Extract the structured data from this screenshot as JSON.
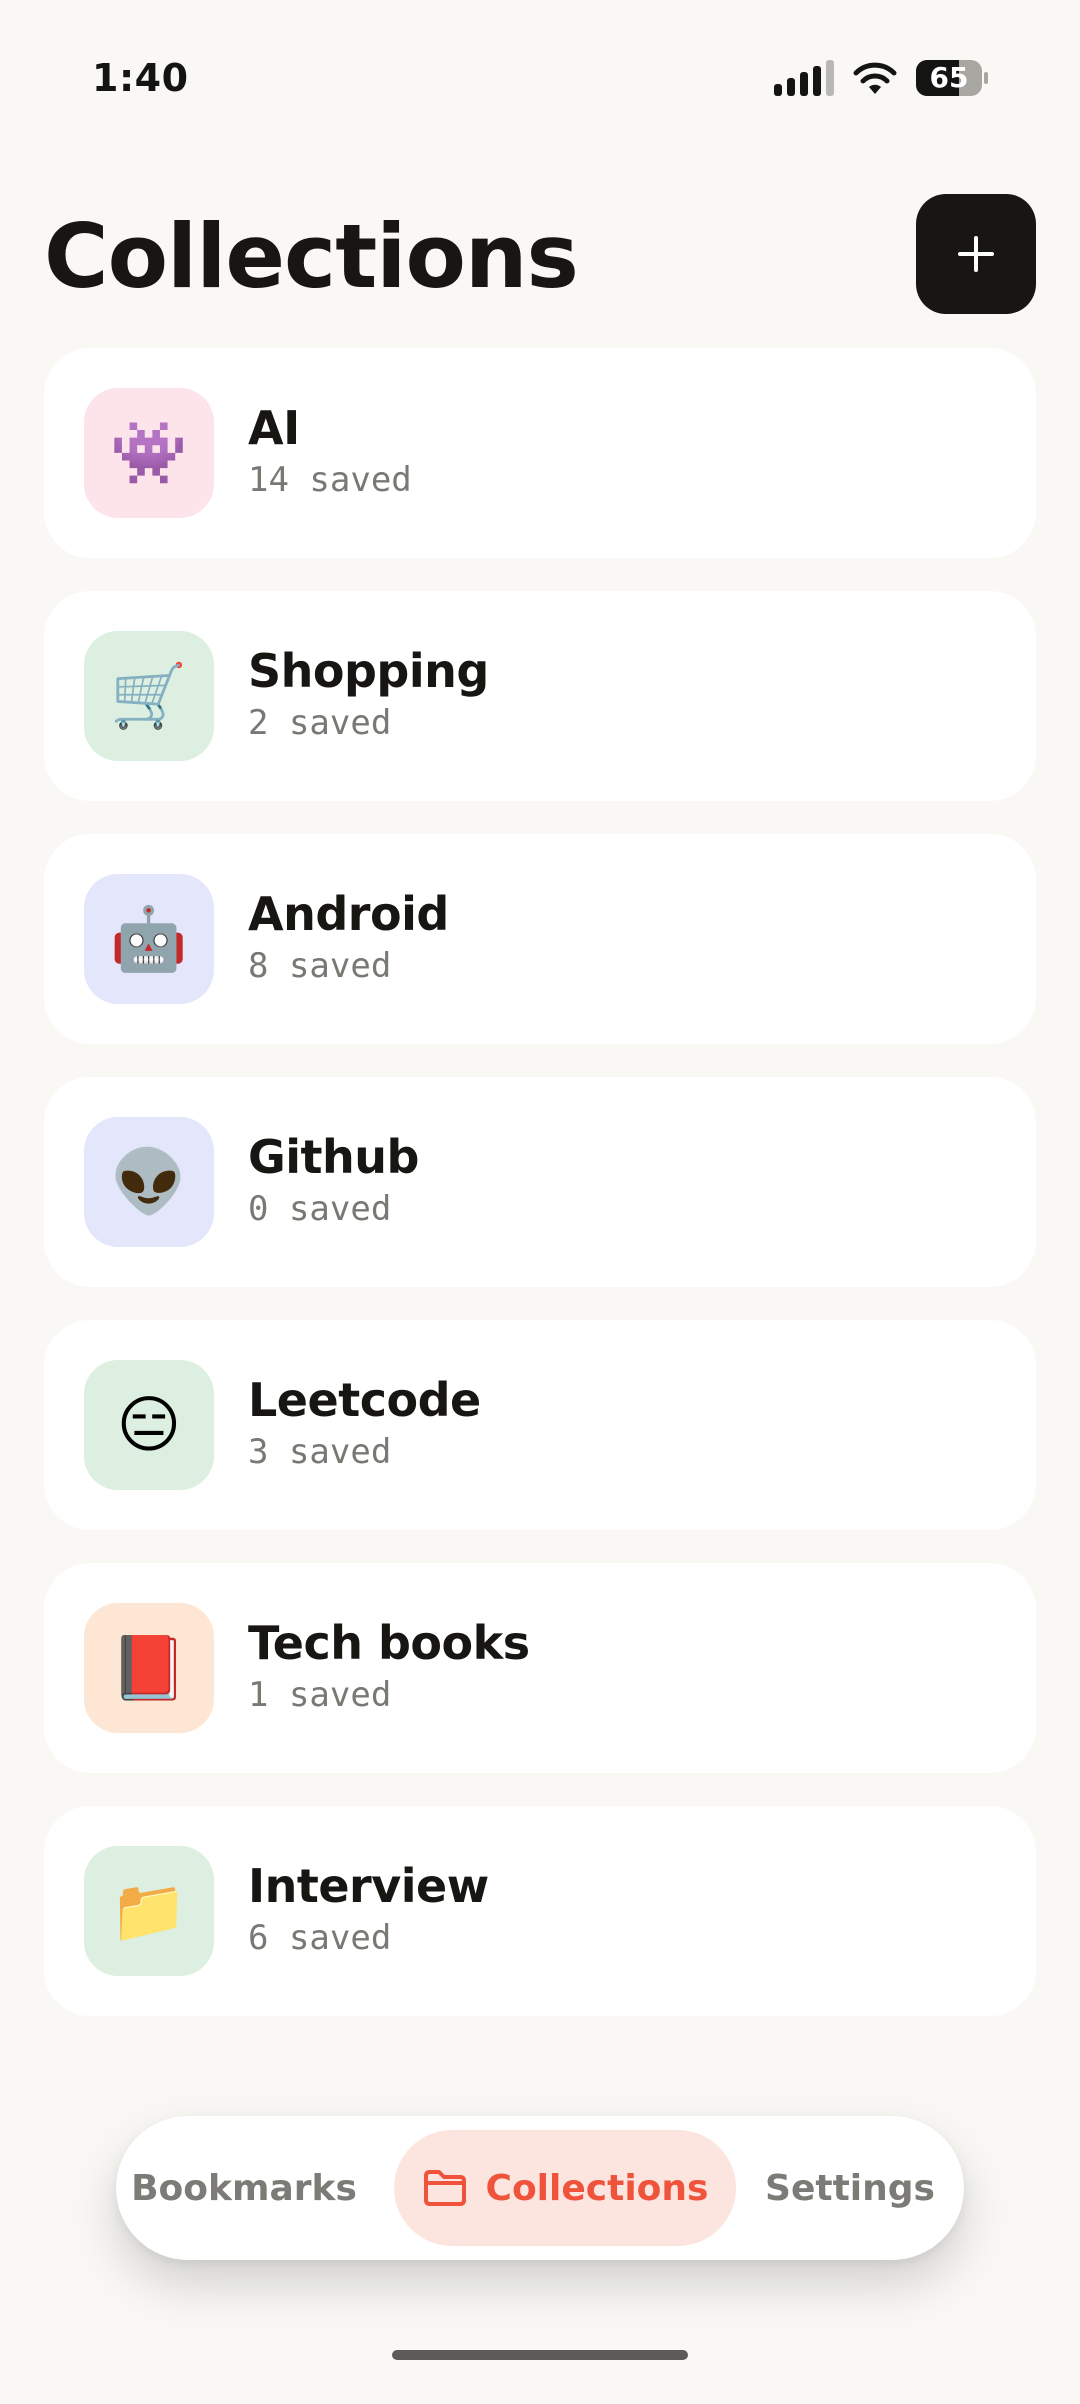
{
  "status_bar": {
    "time": "1:40",
    "battery_level": "65",
    "battery_fraction": 0.65
  },
  "header": {
    "title": "Collections",
    "add_button_icon": "plus-icon"
  },
  "collections": [
    {
      "name": "AI",
      "count": "14 saved",
      "emoji": "👾",
      "icon_name": "alien-monster-icon",
      "bg": "#fde3ea"
    },
    {
      "name": "Shopping",
      "count": "2 saved",
      "emoji": "🛒",
      "icon_name": "shopping-cart-icon",
      "bg": "#dcefe0"
    },
    {
      "name": "Android",
      "count": "8 saved",
      "emoji": "🤖",
      "icon_name": "robot-icon",
      "bg": "#e4e7fb"
    },
    {
      "name": "Github",
      "count": "0 saved",
      "emoji": "👽",
      "icon_name": "alien-icon",
      "bg": "#e4e7fb"
    },
    {
      "name": "Leetcode",
      "count": "3 saved",
      "emoji": "😑",
      "icon_name": "expressionless-face-icon",
      "bg": "#dcefe0"
    },
    {
      "name": "Tech books",
      "count": "1 saved",
      "emoji": "📕",
      "icon_name": "closed-book-icon",
      "bg": "#fde6d3"
    },
    {
      "name": "Interview",
      "count": "6 saved",
      "emoji": "📁",
      "icon_name": "folder-icon",
      "bg": "#dcefe0"
    }
  ],
  "bottom_nav": {
    "items": [
      {
        "label": "Bookmarks",
        "active": false
      },
      {
        "label": "Collections",
        "active": true,
        "icon": "folder-icon"
      },
      {
        "label": "Settings",
        "active": false
      }
    ],
    "accent_color": "#f0533b",
    "active_bg": "#fde5df"
  }
}
